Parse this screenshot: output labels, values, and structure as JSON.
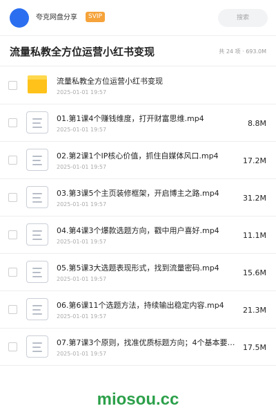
{
  "header": {
    "share_name": "夸克网盘分享",
    "badge": "SVIP",
    "search_placeholder": "搜索"
  },
  "folder": {
    "title": "流量私教全方位运营小红书变现",
    "summary": "共 24 项 · 693.0M"
  },
  "items": [
    {
      "type": "folder",
      "icon": "folder-icon",
      "name": "流量私教全方位运营小红书变现",
      "date": "2025-01-01 19:57",
      "size": ""
    },
    {
      "type": "file",
      "icon": "file-icon",
      "name": "01.第1课4个赚钱维度，打开财富思维.mp4",
      "date": "2025-01-01 19:57",
      "size": "8.8M"
    },
    {
      "type": "file",
      "icon": "file-icon",
      "name": "02.第2课1个IP核心价值，抓住自媒体风口.mp4",
      "date": "2025-01-01 19:57",
      "size": "17.2M"
    },
    {
      "type": "file",
      "icon": "file-icon",
      "name": "03.第3课5个主页装修框架，开启博主之路.mp4",
      "date": "2025-01-01 19:57",
      "size": "31.2M"
    },
    {
      "type": "file",
      "icon": "file-icon",
      "name": "04.第4课3个爆款选题方向，戳中用户喜好.mp4",
      "date": "2025-01-01 19:57",
      "size": "11.1M"
    },
    {
      "type": "file",
      "icon": "file-icon",
      "name": "05.第5课3大选题表现形式，找到流量密码.mp4",
      "date": "2025-01-01 19:57",
      "size": "15.6M"
    },
    {
      "type": "file",
      "icon": "file-icon",
      "name": "06.第6课11个选题方法，持续输出稳定内容.mp4",
      "date": "2025-01-01 19:57",
      "size": "21.3M"
    },
    {
      "type": "file",
      "icon": "file-icon",
      "name": "07.第7课3个原则，找准优质标题方向；4个基本要…",
      "date": "2025-01-01 19:57",
      "size": "17.5M"
    }
  ],
  "watermark": "miosou.cc",
  "colors": {
    "avatar": "#2b6ff0",
    "badge": "#f5a33a",
    "folder": "#ffc21a",
    "watermark": "#2ca04a"
  }
}
